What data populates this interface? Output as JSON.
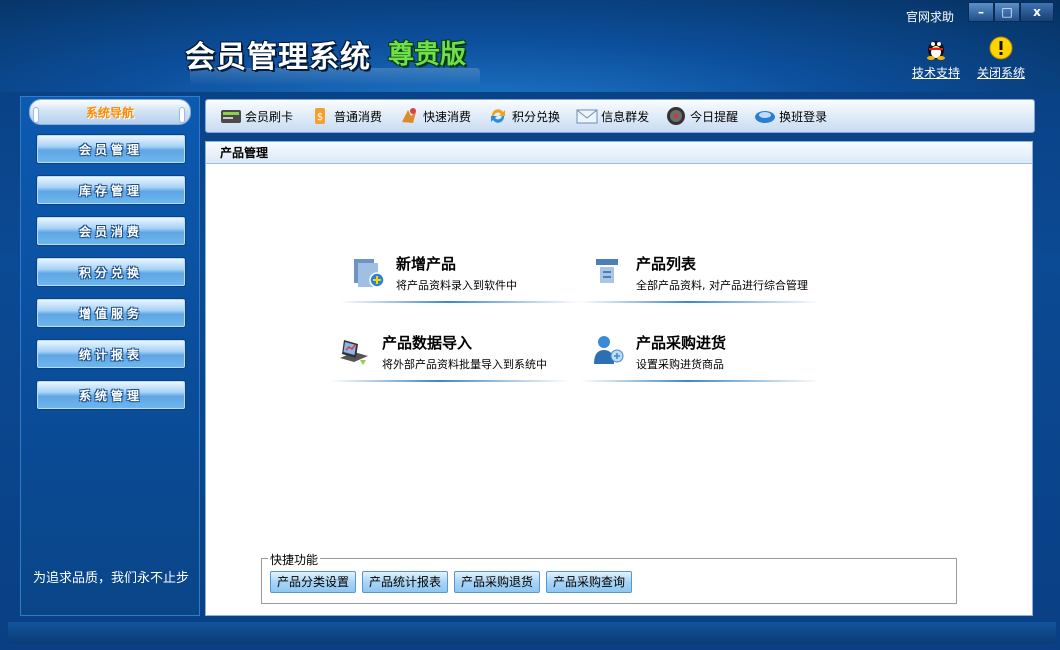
{
  "window": {
    "title": "会员管理系统",
    "edition": "尊贵版",
    "help_link": "官网求助",
    "controls": {
      "minimize": "–",
      "maximize": "□",
      "close": "x"
    }
  },
  "top_tools": [
    {
      "label": "技术支持",
      "icon": "qq-penguin-icon"
    },
    {
      "label": "关闭系统",
      "icon": "warning-icon"
    }
  ],
  "sidebar": {
    "header": "系统导航",
    "items": [
      {
        "label": "会员管理"
      },
      {
        "label": "库存管理"
      },
      {
        "label": "会员消费"
      },
      {
        "label": "积分兑换"
      },
      {
        "label": "增值服务"
      },
      {
        "label": "统计报表"
      },
      {
        "label": "系统管理"
      }
    ],
    "slogan": "为追求品质，我们永不止步"
  },
  "toolbar": {
    "items": [
      {
        "label": "会员刷卡",
        "icon": "card-reader-icon"
      },
      {
        "label": "普通消费",
        "icon": "money-icon"
      },
      {
        "label": "快速消费",
        "icon": "fast-consume-icon"
      },
      {
        "label": "积分兑换",
        "icon": "exchange-icon"
      },
      {
        "label": "信息群发",
        "icon": "mail-icon"
      },
      {
        "label": "今日提醒",
        "icon": "clock-icon"
      },
      {
        "label": "换班登录",
        "icon": "login-icon"
      }
    ]
  },
  "panel": {
    "title": "产品管理",
    "features": [
      {
        "title": "新增产品",
        "desc": "将产品资料录入到软件中",
        "icon": "add-product-icon"
      },
      {
        "title": "产品列表",
        "desc": "全部产品资料, 对产品进行综合管理",
        "icon": "product-list-icon"
      },
      {
        "title": "产品数据导入",
        "desc": "将外部产品资料批量导入到系统中",
        "icon": "import-icon"
      },
      {
        "title": "产品采购进货",
        "desc": "设置采购进货商品",
        "icon": "purchase-icon"
      }
    ],
    "quick": {
      "legend": "快捷功能",
      "buttons": [
        {
          "label": "产品分类设置"
        },
        {
          "label": "产品统计报表"
        },
        {
          "label": "产品采购退货"
        },
        {
          "label": "产品采购查询"
        }
      ]
    }
  },
  "colors": {
    "frame": "#0a3d7e",
    "nav_header_text": "#ff8c00",
    "edition_text": "#6fe04a"
  }
}
